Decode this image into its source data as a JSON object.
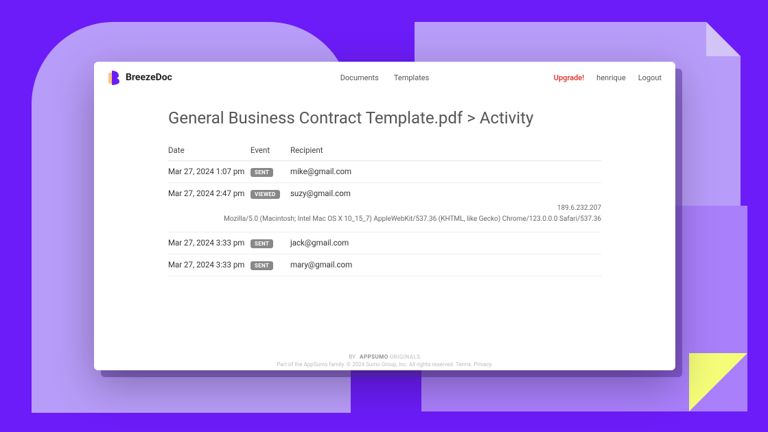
{
  "brand": "BreezeDoc",
  "nav": {
    "documents": "Documents",
    "templates": "Templates",
    "upgrade": "Upgrade!",
    "user": "henrique",
    "logout": "Logout"
  },
  "title": "General Business Contract Template.pdf > Activity",
  "columns": {
    "date": "Date",
    "event": "Event",
    "recipient": "Recipient"
  },
  "rows": [
    {
      "date": "Mar 27, 2024 1:07 pm",
      "event": "SENT",
      "recipient": "mike@gmail.com"
    },
    {
      "date": "Mar 27, 2024 2:47 pm",
      "event": "VIEWED",
      "recipient": "suzy@gmail.com",
      "ip": "189.6.232.207",
      "ua": "Mozilla/5.0 (Macintosh; Intel Mac OS X 10_15_7) AppleWebKit/537.36 (KHTML, like Gecko) Chrome/123.0.0.0 Safari/537.36"
    },
    {
      "date": "Mar 27, 2024 3:33 pm",
      "event": "SENT",
      "recipient": "jack@gmail.com"
    },
    {
      "date": "Mar 27, 2024 3:33 pm",
      "event": "SENT",
      "recipient": "mary@gmail.com"
    }
  ],
  "footer": {
    "by": "BY",
    "brand": "APPSUMO",
    "originals": "ORIGINALS",
    "legal": "Part of the AppSumo family. © 2024 Sumo Group, Inc. All rights reserved. Terms. Privacy."
  }
}
